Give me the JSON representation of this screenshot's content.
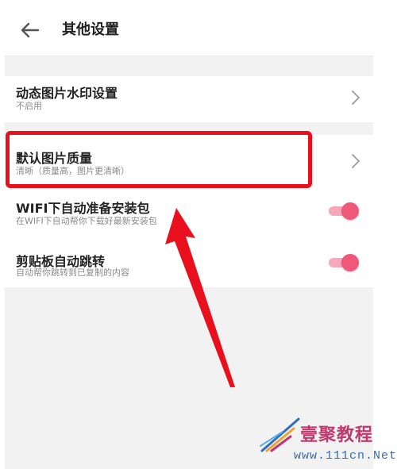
{
  "header": {
    "title": "其他设置"
  },
  "settings": [
    {
      "title": "动态图片水印设置",
      "subtitle": "不启用",
      "control": "chevron"
    },
    {
      "title": "默认图片质量",
      "subtitle": "清晰（质量高，图片更清晰）",
      "control": "chevron"
    },
    {
      "title": "WIFI下自动准备安装包",
      "subtitle": "在WIFI下自动帮你下载好最新安装包",
      "control": "toggle",
      "enabled": true
    },
    {
      "title": "剪贴板自动跳转",
      "subtitle": "自动帮你跳转到已复制的内容",
      "control": "toggle",
      "enabled": true
    }
  ],
  "colors": {
    "toggle_knob": "#f0587a",
    "toggle_track": "#f7a8ba",
    "annotation_red": "#e8101c",
    "watermark_magenta": "#c0396e",
    "watermark_blue": "#2f6fc0"
  },
  "watermark": {
    "text": "壹聚教程",
    "url": "www.111cn.Net"
  }
}
